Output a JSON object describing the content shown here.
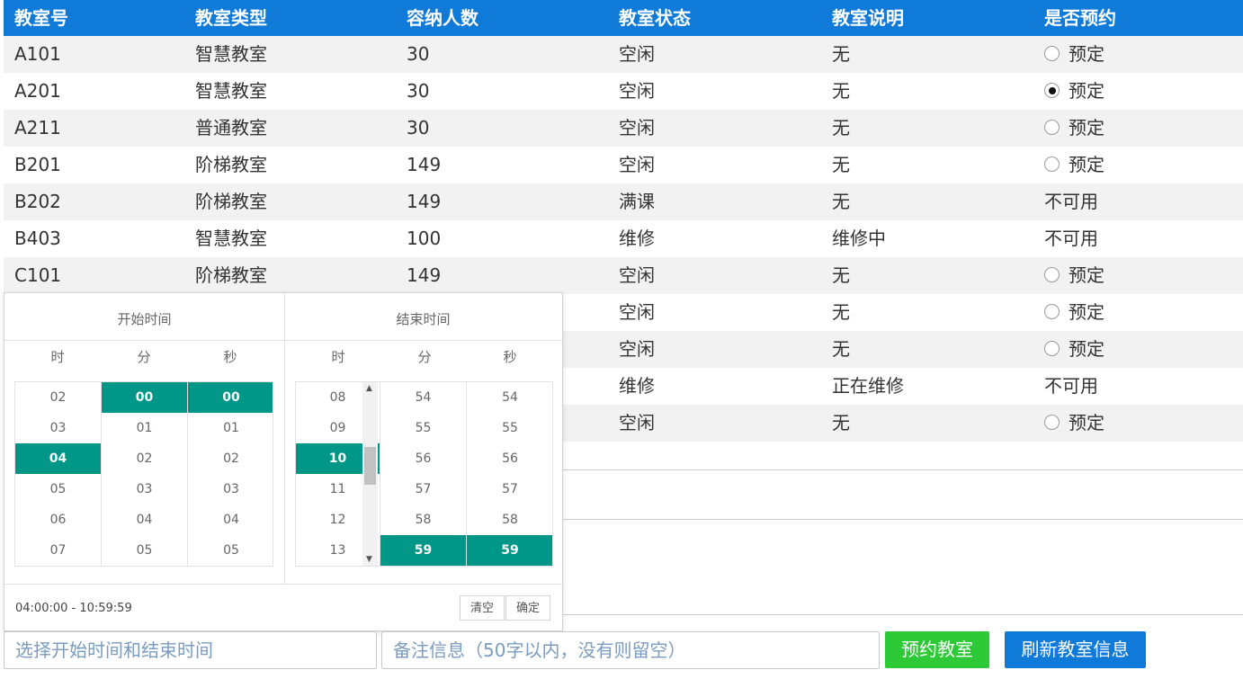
{
  "table": {
    "headers": [
      "教室号",
      "教室类型",
      "容纳人数",
      "教室状态",
      "教室说明",
      "是否预约"
    ],
    "rows": [
      {
        "id": "A101",
        "type": "智慧教室",
        "capacity": "30",
        "status": "空闲",
        "note": "无",
        "reserve": "预定",
        "checked": false
      },
      {
        "id": "A201",
        "type": "智慧教室",
        "capacity": "30",
        "status": "空闲",
        "note": "无",
        "reserve": "预定",
        "checked": true
      },
      {
        "id": "A211",
        "type": "普通教室",
        "capacity": "30",
        "status": "空闲",
        "note": "无",
        "reserve": "预定",
        "checked": false
      },
      {
        "id": "B201",
        "type": "阶梯教室",
        "capacity": "149",
        "status": "空闲",
        "note": "无",
        "reserve": "预定",
        "checked": false
      },
      {
        "id": "B202",
        "type": "阶梯教室",
        "capacity": "149",
        "status": "满课",
        "note": "无",
        "reserve": "不可用",
        "checked": false
      },
      {
        "id": "B403",
        "type": "智慧教室",
        "capacity": "100",
        "status": "维修",
        "note": "维修中",
        "reserve": "不可用",
        "checked": false
      },
      {
        "id": "C101",
        "type": "阶梯教室",
        "capacity": "149",
        "status": "空闲",
        "note": "无",
        "reserve": "预定",
        "checked": false
      },
      {
        "id": "",
        "type": "",
        "capacity": "",
        "status": "空闲",
        "note": "无",
        "reserve": "预定",
        "checked": false
      },
      {
        "id": "",
        "type": "",
        "capacity": "",
        "status": "空闲",
        "note": "无",
        "reserve": "预定",
        "checked": false
      },
      {
        "id": "",
        "type": "",
        "capacity": "",
        "status": "维修",
        "note": "正在维修",
        "reserve": "不可用",
        "checked": false
      },
      {
        "id": "",
        "type": "",
        "capacity": "",
        "status": "空闲",
        "note": "无",
        "reserve": "预定",
        "checked": false
      }
    ]
  },
  "picker": {
    "start_title": "开始时间",
    "end_title": "结束时间",
    "col_labels": [
      "时",
      "分",
      "秒"
    ],
    "start": {
      "hours": [
        "02",
        "03",
        "04",
        "05",
        "06",
        "07"
      ],
      "hour_sel": "04",
      "minutes": [
        "00",
        "01",
        "02",
        "03",
        "04",
        "05"
      ],
      "minute_sel": "00",
      "seconds": [
        "00",
        "01",
        "02",
        "03",
        "04",
        "05"
      ],
      "second_sel": "00"
    },
    "end": {
      "hours": [
        "08",
        "09",
        "10",
        "11",
        "12",
        "13"
      ],
      "hour_sel": "10",
      "minutes": [
        "54",
        "55",
        "56",
        "57",
        "58",
        "59"
      ],
      "minute_sel": "59",
      "seconds": [
        "54",
        "55",
        "56",
        "57",
        "58",
        "59"
      ],
      "second_sel": "59"
    },
    "range_text": "04:00:00 - 10:59:59",
    "clear_label": "清空",
    "confirm_label": "确定"
  },
  "footer": {
    "time_placeholder": "选择开始时间和结束时间",
    "note_placeholder": "备注信息（50字以内，没有则留空）",
    "reserve_button": "预约教室",
    "refresh_button": "刷新教室信息",
    "reserve_color": "#2dc937",
    "refresh_color": "#0f7ad8"
  },
  "colors": {
    "header_bg": "#0f7ad8",
    "picker_selected": "#009688"
  }
}
